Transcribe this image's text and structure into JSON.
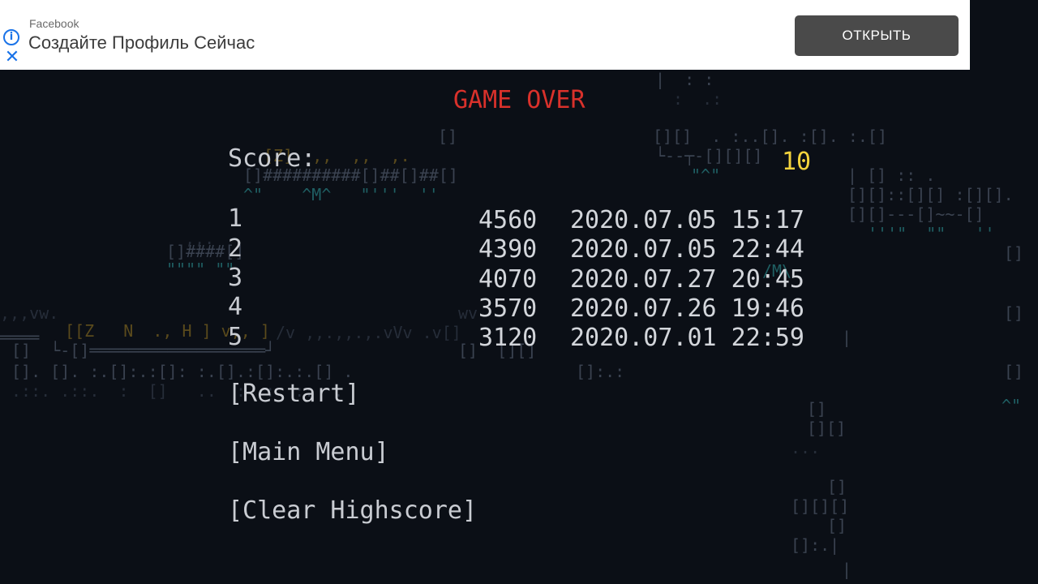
{
  "ad": {
    "brand": "Facebook",
    "headline": "Создайте Профиль Сейчас",
    "cta_label": "ОТКРЫТЬ",
    "info_icon": "info-icon",
    "close_icon": "close-icon",
    "accent_color": "#1a73e8"
  },
  "game_over": {
    "title": "GAME OVER",
    "score_label": "Score:",
    "score_value": "10"
  },
  "highscores": [
    {
      "rank": "1",
      "score": "4560",
      "date": "2020.07.05 15:17"
    },
    {
      "rank": "2",
      "score": "4390",
      "date": "2020.07.05 22:44"
    },
    {
      "rank": "3",
      "score": "4070",
      "date": "2020.07.27 20:45"
    },
    {
      "rank": "4",
      "score": "3570",
      "date": "2020.07.26 19:46"
    },
    {
      "rank": "5",
      "score": "3120",
      "date": "2020.07.01 22:59"
    }
  ],
  "menu": {
    "restart": "[Restart]",
    "main_menu": "[Main Menu]",
    "clear_highscore": "[Clear Highscore]"
  },
  "colors": {
    "background": "#0b0f16",
    "title": "#d9312b",
    "score_value": "#f3d33d",
    "text": "#c9ccd2"
  }
}
